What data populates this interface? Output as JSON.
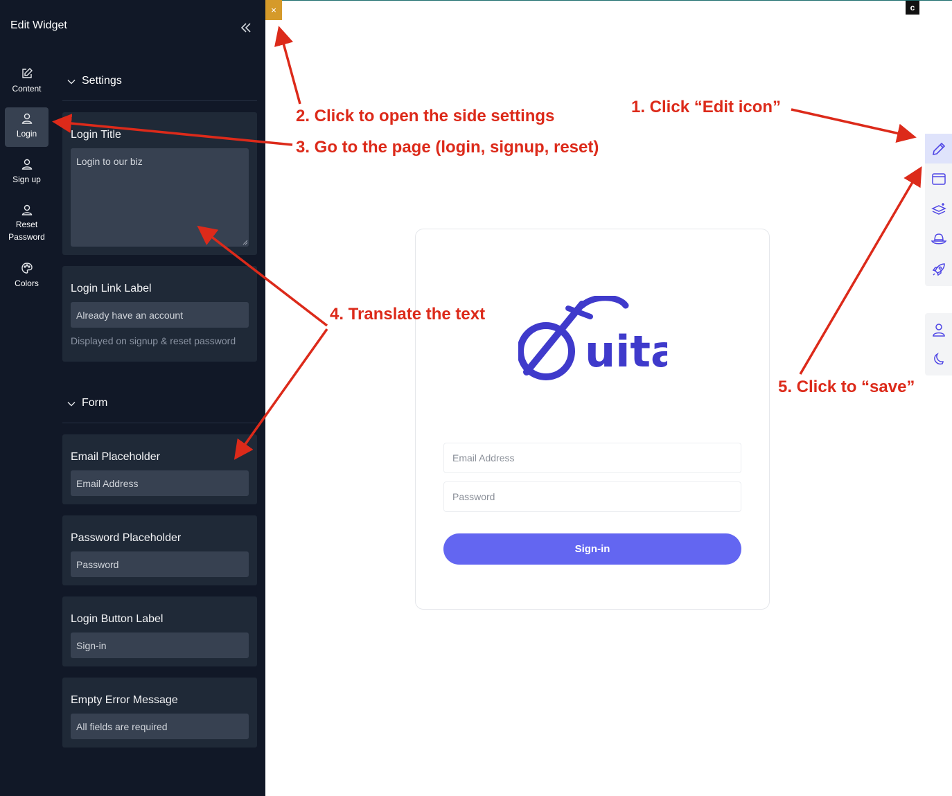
{
  "panel": {
    "title": "Edit Widget",
    "rail": [
      {
        "label": "Content",
        "icon": "edit-icon",
        "active": false
      },
      {
        "label": "Login",
        "icon": "user-icon",
        "active": true
      },
      {
        "label": "Sign up",
        "icon": "user-icon",
        "active": false
      },
      {
        "label": "Reset Password",
        "icon": "user-icon",
        "active": false
      },
      {
        "label": "Colors",
        "icon": "palette-icon",
        "active": false
      }
    ],
    "sections": {
      "settings": "Settings",
      "form": "Form"
    },
    "fields": {
      "login_title": {
        "label": "Login Title",
        "value": "Login to our biz"
      },
      "login_link_label": {
        "label": "Login Link Label",
        "value": "Already have an account",
        "hint": "Displayed on signup & reset password"
      },
      "email_placeholder": {
        "label": "Email Placeholder",
        "value": "Email Address"
      },
      "password_placeholder": {
        "label": "Password Placeholder",
        "value": "Password"
      },
      "login_button_label": {
        "label": "Login Button Label",
        "value": "Sign-in"
      },
      "empty_error_message": {
        "label": "Empty Error Message",
        "value": "All fields are required"
      }
    }
  },
  "preview": {
    "close_symbol": "×",
    "corner_badge": "c",
    "logo_text": "uita",
    "email_placeholder": "Email Address",
    "password_placeholder": "Password",
    "signin_label": "Sign-in"
  },
  "toolbar": {
    "buttons": [
      "pencil-icon",
      "browser-window-icon",
      "layers-icon",
      "hat-icon",
      "rocket-icon"
    ],
    "secondary": [
      "user-icon",
      "moon-icon"
    ]
  },
  "annotations": {
    "step1": "1. Click “Edit icon”",
    "step2": "2. Click to open the side settings",
    "step3": "3. Go to the page (login, signup, reset)",
    "step4": "4. Translate the text",
    "step5": "5. Click to “save”"
  },
  "colors": {
    "panel_bg": "#111827",
    "card_bg": "#1f2937",
    "accent": "#6366f1",
    "logo": "#3f3acb",
    "annotation": "#dc2a1a",
    "close_button": "#d59a2a"
  }
}
